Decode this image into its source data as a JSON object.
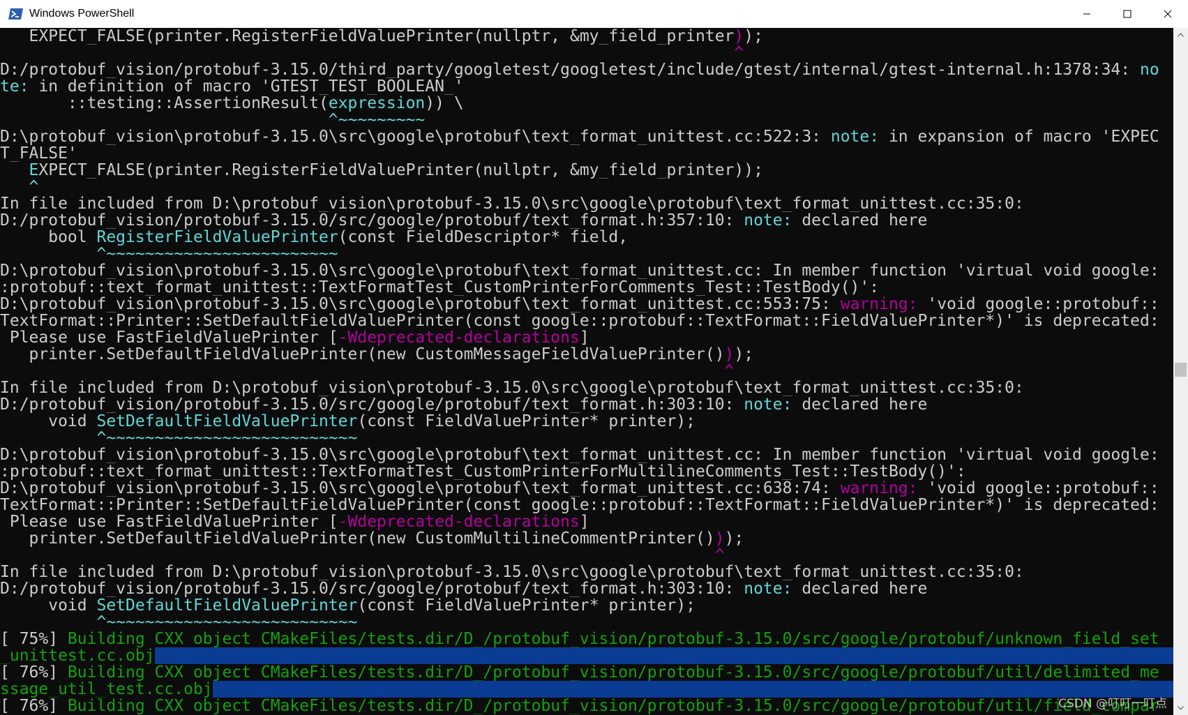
{
  "window": {
    "title": "Windows PowerShell",
    "icon": "powershell-icon",
    "controls": [
      "minimize-icon",
      "maximize-icon",
      "close-icon"
    ]
  },
  "colors": {
    "background": "#0c0c0c",
    "default_text": "#cccccc",
    "note": "#61d6d6",
    "warning": "#b4009e",
    "build": "#13a10e",
    "selection": "#0b3c93"
  },
  "watermark": "CSDN @叮叮一叮点",
  "lines": [
    [
      {
        "t": "   EXPECT_FALSE(printer.RegisterFieldValuePrinter(nullptr, &my_field_printer",
        "c": "default"
      },
      {
        "t": ")",
        "c": "magenta"
      },
      {
        "t": ");",
        "c": "default"
      }
    ],
    [
      {
        "t": "                                                                            ^",
        "c": "magenta"
      }
    ],
    [
      {
        "t": "D:/protobuf_vision/protobuf-3.15.0/third_party/googletest/googletest/include/gtest/internal/gtest-internal.h:1378:34: ",
        "c": "default"
      },
      {
        "t": "no",
        "c": "cyan"
      }
    ],
    [
      {
        "t": "te:",
        "c": "cyan"
      },
      {
        "t": " in definition of macro 'GTEST_TEST_BOOLEAN_'",
        "c": "default"
      }
    ],
    [
      {
        "t": "       ::testing::AssertionResult(",
        "c": "default"
      },
      {
        "t": "expression",
        "c": "cyan"
      },
      {
        "t": ")) \\",
        "c": "default"
      }
    ],
    [
      {
        "t": "                                  ^~~~~~~~~~",
        "c": "cyan"
      }
    ],
    [
      {
        "t": "D:\\protobuf_vision\\protobuf-3.15.0\\src\\google\\protobuf\\text_format_unittest.cc:522:3: ",
        "c": "default"
      },
      {
        "t": "note:",
        "c": "cyan"
      },
      {
        "t": " in expansion of macro 'EXPEC",
        "c": "default"
      }
    ],
    [
      {
        "t": "T_FALSE'",
        "c": "default"
      }
    ],
    [
      {
        "t": "   ",
        "c": "default"
      },
      {
        "t": "E",
        "c": "cyan"
      },
      {
        "t": "XPECT_FALSE(printer.RegisterFieldValuePrinter(nullptr, &my_field_printer));",
        "c": "default"
      }
    ],
    [
      {
        "t": "   ^",
        "c": "cyan"
      }
    ],
    [
      {
        "t": "In file included from D:\\protobuf_vision\\protobuf-3.15.0\\src\\google\\protobuf\\text_format_unittest.cc:35:0:",
        "c": "default"
      }
    ],
    [
      {
        "t": "D:/protobuf_vision/protobuf-3.15.0/src/google/protobuf/text_format.h:357:10: ",
        "c": "default"
      },
      {
        "t": "note:",
        "c": "cyan"
      },
      {
        "t": " declared here",
        "c": "default"
      }
    ],
    [
      {
        "t": "     bool ",
        "c": "default"
      },
      {
        "t": "RegisterFieldValuePrinter",
        "c": "cyan"
      },
      {
        "t": "(const FieldDescriptor* field,",
        "c": "default"
      }
    ],
    [
      {
        "t": "          ^~~~~~~~~~~~~~~~~~~~~~~~~",
        "c": "cyan"
      }
    ],
    [
      {
        "t": "D:\\protobuf_vision\\protobuf-3.15.0\\src\\google\\protobuf\\text_format_unittest.cc: In member function 'virtual void google:",
        "c": "default"
      }
    ],
    [
      {
        "t": ":protobuf::text_format_unittest::TextFormatTest_CustomPrinterForComments_Test::TestBody()':",
        "c": "default"
      }
    ],
    [
      {
        "t": "D:\\protobuf_vision\\protobuf-3.15.0\\src\\google\\protobuf\\text_format_unittest.cc:553:75: ",
        "c": "default"
      },
      {
        "t": "warning:",
        "c": "magenta"
      },
      {
        "t": " 'void google::protobuf::",
        "c": "default"
      }
    ],
    [
      {
        "t": "TextFormat::Printer::SetDefaultFieldValuePrinter(const google::protobuf::TextFormat::FieldValuePrinter*)' is deprecated:",
        "c": "default"
      }
    ],
    [
      {
        "t": " Please use FastFieldValuePrinter [",
        "c": "default"
      },
      {
        "t": "-Wdeprecated-declarations",
        "c": "magenta"
      },
      {
        "t": "]",
        "c": "default"
      }
    ],
    [
      {
        "t": "   printer.SetDefaultFieldValuePrinter(new CustomMessageFieldValuePrinter()",
        "c": "default"
      },
      {
        "t": ")",
        "c": "magenta"
      },
      {
        "t": ");",
        "c": "default"
      }
    ],
    [
      {
        "t": "                                                                           ^",
        "c": "magenta"
      }
    ],
    [
      {
        "t": "In file included from D:\\protobuf_vision\\protobuf-3.15.0\\src\\google\\protobuf\\text_format_unittest.cc:35:0:",
        "c": "default"
      }
    ],
    [
      {
        "t": "D:/protobuf_vision/protobuf-3.15.0/src/google/protobuf/text_format.h:303:10: ",
        "c": "default"
      },
      {
        "t": "note:",
        "c": "cyan"
      },
      {
        "t": " declared here",
        "c": "default"
      }
    ],
    [
      {
        "t": "     void ",
        "c": "default"
      },
      {
        "t": "SetDefaultFieldValuePrinter",
        "c": "cyan"
      },
      {
        "t": "(const FieldValuePrinter* printer);",
        "c": "default"
      }
    ],
    [
      {
        "t": "          ^~~~~~~~~~~~~~~~~~~~~~~~~~~",
        "c": "cyan"
      }
    ],
    [
      {
        "t": "D:\\protobuf_vision\\protobuf-3.15.0\\src\\google\\protobuf\\text_format_unittest.cc: In member function 'virtual void google:",
        "c": "default"
      }
    ],
    [
      {
        "t": ":protobuf::text_format_unittest::TextFormatTest_CustomPrinterForMultilineComments_Test::TestBody()':",
        "c": "default"
      }
    ],
    [
      {
        "t": "D:\\protobuf_vision\\protobuf-3.15.0\\src\\google\\protobuf\\text_format_unittest.cc:638:74: ",
        "c": "default"
      },
      {
        "t": "warning:",
        "c": "magenta"
      },
      {
        "t": " 'void google::protobuf::",
        "c": "default"
      }
    ],
    [
      {
        "t": "TextFormat::Printer::SetDefaultFieldValuePrinter(const google::protobuf::TextFormat::FieldValuePrinter*)' is deprecated:",
        "c": "default"
      }
    ],
    [
      {
        "t": " Please use FastFieldValuePrinter [",
        "c": "default"
      },
      {
        "t": "-Wdeprecated-declarations",
        "c": "magenta"
      },
      {
        "t": "]",
        "c": "default"
      }
    ],
    [
      {
        "t": "   printer.SetDefaultFieldValuePrinter(new CustomMultilineCommentPrinter()",
        "c": "default"
      },
      {
        "t": ")",
        "c": "magenta"
      },
      {
        "t": ");",
        "c": "default"
      }
    ],
    [
      {
        "t": "                                                                          ^",
        "c": "magenta"
      }
    ],
    [
      {
        "t": "In file included from D:\\protobuf_vision\\protobuf-3.15.0\\src\\google\\protobuf\\text_format_unittest.cc:35:0:",
        "c": "default"
      }
    ],
    [
      {
        "t": "D:/protobuf_vision/protobuf-3.15.0/src/google/protobuf/text_format.h:303:10: ",
        "c": "default"
      },
      {
        "t": "note:",
        "c": "cyan"
      },
      {
        "t": " declared here",
        "c": "default"
      }
    ],
    [
      {
        "t": "     void ",
        "c": "default"
      },
      {
        "t": "SetDefaultFieldValuePrinter",
        "c": "cyan"
      },
      {
        "t": "(const FieldValuePrinter* printer);",
        "c": "default"
      }
    ],
    [
      {
        "t": "          ^~~~~~~~~~~~~~~~~~~~~~~~~~~",
        "c": "cyan"
      }
    ],
    [
      {
        "t": "[ 75%] ",
        "c": "default"
      },
      {
        "t": "Building CXX object CMakeFiles/tests.dir/D_/protobuf_vision/protobuf-3.15.0/src/google/protobuf/unknown_field_set",
        "c": "green"
      }
    ],
    [
      {
        "t": "_unittest.cc.obj",
        "c": "green"
      },
      {
        "t": "                                                                                                              ",
        "c": "default",
        "hl": true
      }
    ],
    [
      {
        "t": "[ 76%] ",
        "c": "default"
      },
      {
        "t": "Building CXX object CMakeFiles/tests.dir/D_/protobuf_vision/protobuf-3.15.0/src/google/protobuf/util/delimited_me",
        "c": "green"
      }
    ],
    [
      {
        "t": "ssage_util_test.cc.obj",
        "c": "green"
      },
      {
        "t": "                                                                                                        ",
        "c": "default",
        "hl": true
      }
    ],
    [
      {
        "t": "[ 76%] ",
        "c": "default"
      },
      {
        "t": "Building CXX object CMakeFiles/tests.dir/D_/protobuf_vision/protobuf-3.15.0/src/google/protobuf/util/field_compar",
        "c": "green"
      }
    ]
  ]
}
